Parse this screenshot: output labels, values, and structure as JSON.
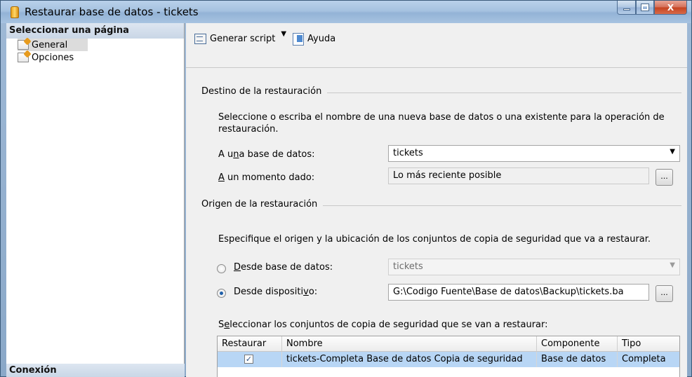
{
  "window": {
    "title": "Restaurar base de datos - tickets",
    "controls": {
      "minimize": "minimize-icon",
      "maximize": "maximize-icon",
      "close": "X"
    }
  },
  "left": {
    "header": "Seleccionar una página",
    "pages": [
      {
        "label": "General",
        "icon": "page-icon",
        "selected": true
      },
      {
        "label": "Opciones",
        "icon": "page-icon",
        "selected": false
      }
    ],
    "footer": "Conexión"
  },
  "toolbar": {
    "script_label": "Generar script",
    "script_icon": "script-icon",
    "help_label": "Ayuda",
    "help_icon": "help-icon"
  },
  "destino": {
    "title": "Destino de la restauración",
    "desc": "Seleccione o escriba el nombre de una nueva base de datos o una existente para la operación de restauración.",
    "db_label_pre": "A u",
    "db_label_u": "n",
    "db_label_post": "a base de datos:",
    "db_value": "tickets",
    "moment_label_u": "A",
    "moment_label_post": " un momento dado:",
    "moment_value": "Lo más reciente posible",
    "ellipsis": "..."
  },
  "origen": {
    "title": "Origen de la restauración",
    "desc": "Especifique el origen y la ubicación de los conjuntos de copia de seguridad que va a restaurar.",
    "from_db_u": "D",
    "from_db_post": "esde base de datos:",
    "from_db_value": "tickets",
    "from_db_selected": false,
    "from_dev_pre": "Desde dispositi",
    "from_dev_u": "v",
    "from_dev_post": "o:",
    "from_dev_value": "G:\\Codigo Fuente\\Base de datos\\Backup\\tickets.ba",
    "from_dev_selected": true,
    "ellipsis": "...",
    "sets_pre": "S",
    "sets_u": "e",
    "sets_post": "leccionar los conjuntos de copia de seguridad que se van a restaurar:"
  },
  "grid": {
    "columns": [
      "Restaurar",
      "Nombre",
      "Componente",
      "Tipo"
    ],
    "rows": [
      {
        "restore": true,
        "check": "✓",
        "name": "tickets-Completa Base de datos Copia de seguridad",
        "component": "Base de datos",
        "type": "Completa"
      }
    ]
  }
}
